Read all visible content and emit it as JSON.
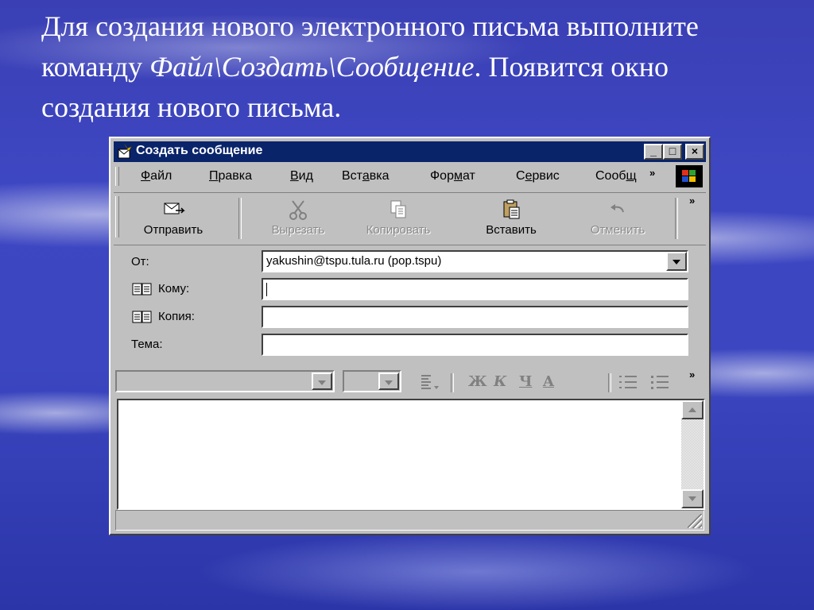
{
  "slide": {
    "line1": "Для создания нового электронного письма выполните",
    "line2_prefix": "команду ",
    "line2_command": "Файл\\Создать\\Сообщение",
    "line2_suffix": ". Появится окно",
    "line3": "создания нового письма."
  },
  "window": {
    "title": "Создать сообщение",
    "controls": {
      "minimize": "_",
      "maximize": "□",
      "close": "×"
    }
  },
  "menu": {
    "items": [
      {
        "pre": "",
        "key": "Ф",
        "post": "айл"
      },
      {
        "pre": "",
        "key": "П",
        "post": "равка"
      },
      {
        "pre": "",
        "key": "В",
        "post": "ид"
      },
      {
        "pre": "Вст",
        "key": "а",
        "post": "вка"
      },
      {
        "pre": "Фор",
        "key": "м",
        "post": "ат"
      },
      {
        "pre": "С",
        "key": "е",
        "post": "рвис"
      },
      {
        "pre": "Сооб",
        "key": "щ",
        "post": ""
      }
    ],
    "overflow": "»"
  },
  "toolbar": {
    "send": "Отправить",
    "cut": "Вырезать",
    "copy": "Копировать",
    "paste": "Вставить",
    "undo": "Отменить",
    "overflow": "»"
  },
  "headers": {
    "from_label": "От:",
    "from_value": "yakushin@tspu.tula.ru     (pop.tspu)",
    "to_label": "Кому:",
    "cc_label": "Копия:",
    "subject_label": "Тема:",
    "to_value": "",
    "cc_value": "",
    "subject_value": ""
  },
  "format_bar": {
    "bold": "Ж",
    "italic": "К",
    "underline": "Ч",
    "font_color": "A",
    "overflow": "»"
  },
  "colors": {
    "titlebar": "#0a246a",
    "window_face": "#c0c0c0",
    "slide_background": "#3b46c0"
  }
}
